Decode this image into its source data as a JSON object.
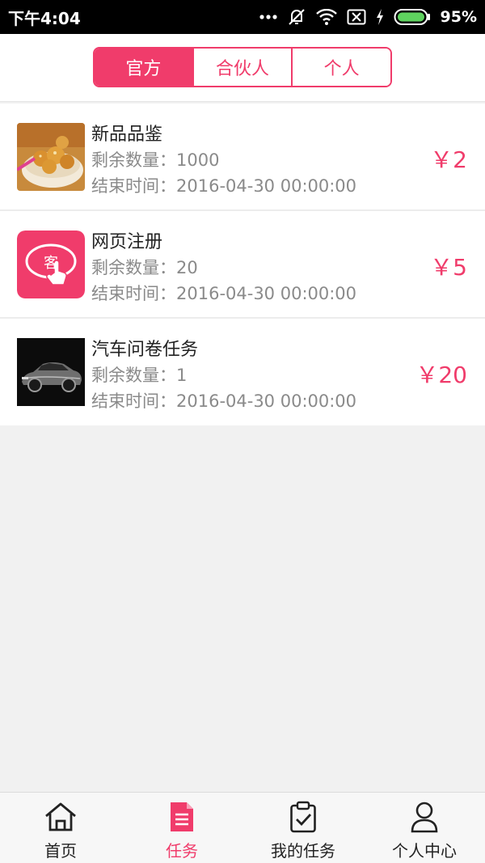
{
  "status_bar": {
    "time": "下午4:04",
    "battery": "95%",
    "icons": [
      "more-dots-icon",
      "mute-vibrate-icon",
      "wifi-icon",
      "no-sim-icon",
      "charging-icon",
      "battery-icon"
    ]
  },
  "tabs": [
    {
      "label": "官方",
      "active": true
    },
    {
      "label": "合伙人",
      "active": false
    },
    {
      "label": "个人",
      "active": false
    }
  ],
  "tasks": [
    {
      "title": "新品品鉴",
      "remain": "剩余数量：1000",
      "end_time": "结束时间：2016-04-30 00:00:00",
      "price": "￥2",
      "thumb": "food-image"
    },
    {
      "title": "网页注册",
      "remain": "剩余数量：20",
      "end_time": "结束时间：2016-04-30 00:00:00",
      "price": "￥5",
      "thumb": "app-logo-image",
      "thumb_text": "客"
    },
    {
      "title": "汽车问卷任务",
      "remain": "剩余数量：1",
      "end_time": "结束时间：2016-04-30 00:00:00",
      "price": "￥20",
      "thumb": "car-image"
    }
  ],
  "bottom_nav": [
    {
      "label": "首页",
      "icon": "home-icon",
      "active": false
    },
    {
      "label": "任务",
      "icon": "document-icon",
      "active": true
    },
    {
      "label": "我的任务",
      "icon": "clipboard-check-icon",
      "active": false
    },
    {
      "label": "个人中心",
      "icon": "person-icon",
      "active": false
    }
  ],
  "colors": {
    "accent": "#f03c6b",
    "text": "#222222",
    "muted": "#8a8a8a",
    "background": "#f1f1f1"
  }
}
